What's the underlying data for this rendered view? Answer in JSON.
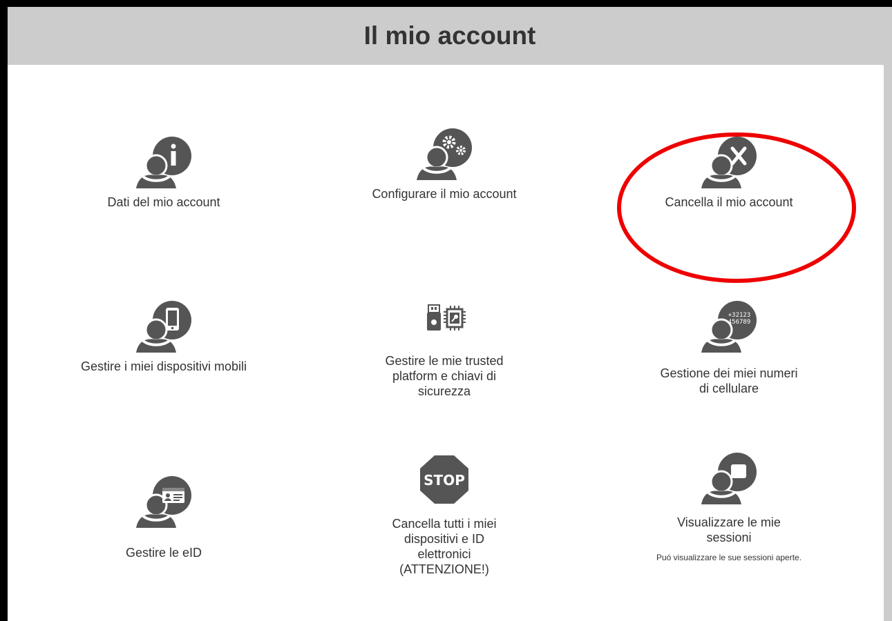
{
  "page": {
    "title": "Il mio account"
  },
  "tiles": [
    {
      "name": "Dati del mio account"
    },
    {
      "name": "Configurare il mio account"
    },
    {
      "name": "Cancella il mio account"
    },
    {
      "name": "Gestire i miei dispositivi mobili"
    },
    {
      "name": "Gestire le mie trusted platform e chiavi di sicurezza"
    },
    {
      "name": "Gestione dei miei numeri di cellulare",
      "icon_text": "+32123\n456789"
    },
    {
      "name": "Gestire le eID"
    },
    {
      "name": "Cancella tutti i miei dispositivi e ID elettronici (ATTENZIONE!)",
      "icon_text": "STOP"
    },
    {
      "name": "Visualizzare le mie sessioni",
      "description": "Puó visualizzare le sue sessioni aperte."
    }
  ],
  "icons": {
    "account-info": "person-info-icon",
    "account-config": "person-gears-icon",
    "account-delete": "person-x-icon",
    "mobile": "person-phone-icon",
    "security-keys": "usb-chip-icon",
    "phone-numbers": "person-numbers-icon",
    "eid": "person-id-card-icon",
    "stop": "stop-sign-icon",
    "sessions": "person-session-icon"
  },
  "colors": {
    "header_bg": "#cccccc",
    "icon": "#555555",
    "text": "#333333",
    "highlight": "#ee0000"
  }
}
